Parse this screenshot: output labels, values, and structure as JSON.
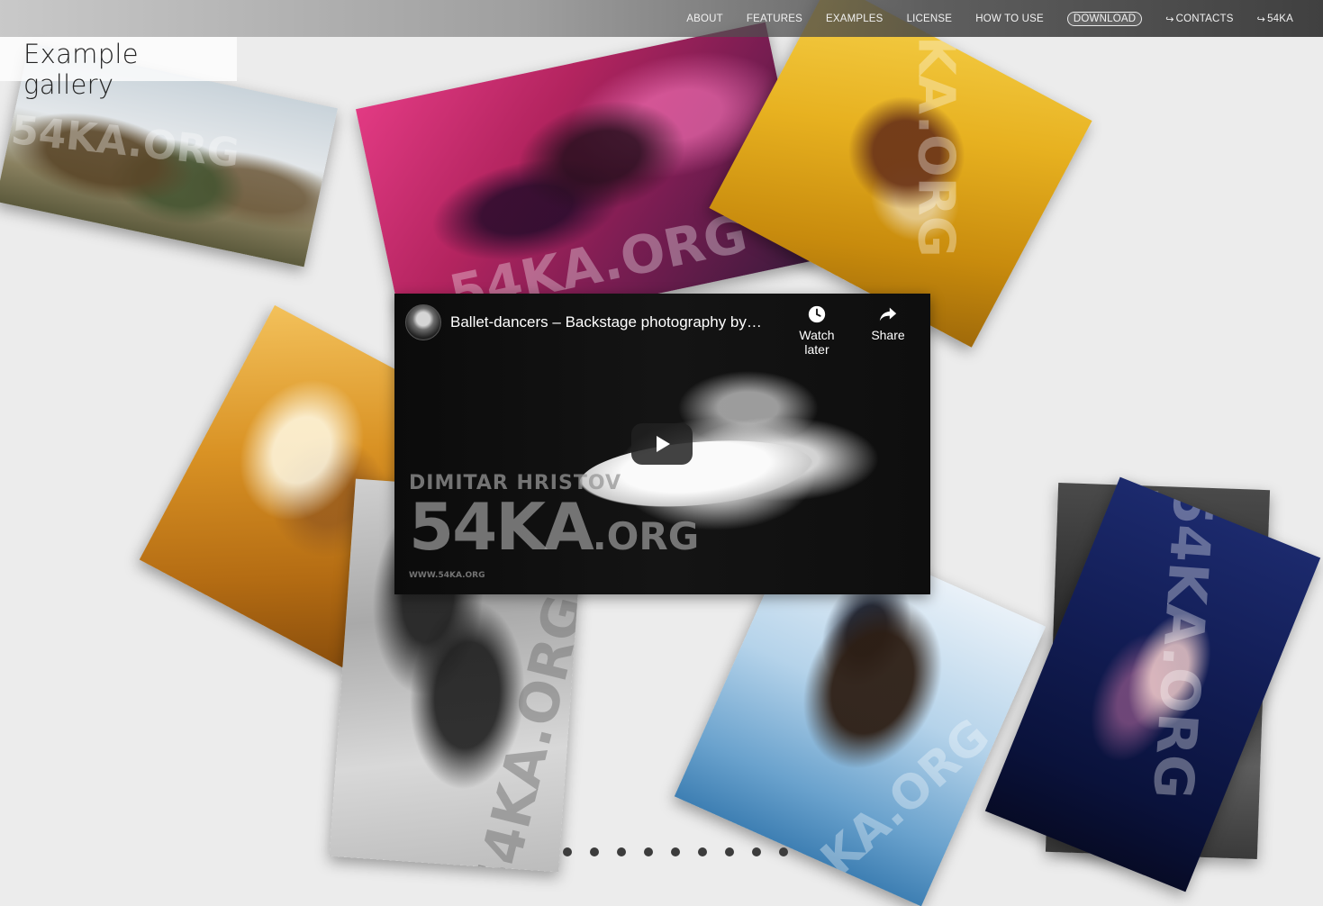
{
  "nav": {
    "items": [
      {
        "label": "ABOUT"
      },
      {
        "label": "FEATURES"
      },
      {
        "label": "EXAMPLES"
      },
      {
        "label": "LICENSE"
      },
      {
        "label": "HOW TO USE"
      },
      {
        "label": "DOWNLOAD",
        "highlighted": true
      },
      {
        "label": "CONTACTS",
        "icon": "external-link-icon"
      },
      {
        "label": "54KA",
        "icon": "external-link-icon"
      }
    ]
  },
  "page": {
    "title": "Example gallery"
  },
  "video": {
    "title": "Ballet-dancers – Backstage photography by…",
    "watch_later_label": "Watch later",
    "share_label": "Share",
    "watermark_name": "DIMITAR HRISTOV",
    "watermark_logo": "54KA",
    "watermark_logo_suffix": ".ORG",
    "watermark_url": "WWW.54KA.ORG"
  },
  "gallery": {
    "watermark": "54KA.ORG",
    "photos": [
      {
        "subject": "soldiers-parade"
      },
      {
        "subject": "guitarist-on-stage"
      },
      {
        "subject": "rider-in-yellow-field"
      },
      {
        "subject": "girl-with-hat"
      },
      {
        "subject": "singer-black-and-white"
      },
      {
        "subject": "horse-rider-in-sea"
      },
      {
        "subject": "dancers-black-and-white"
      },
      {
        "subject": "dancers-blue-stage"
      }
    ]
  },
  "pagination": {
    "dot_count": 9
  },
  "colors": {
    "background": "#ececec",
    "nav_text": "#f2f2f2",
    "dot": "#3c3c3c"
  }
}
